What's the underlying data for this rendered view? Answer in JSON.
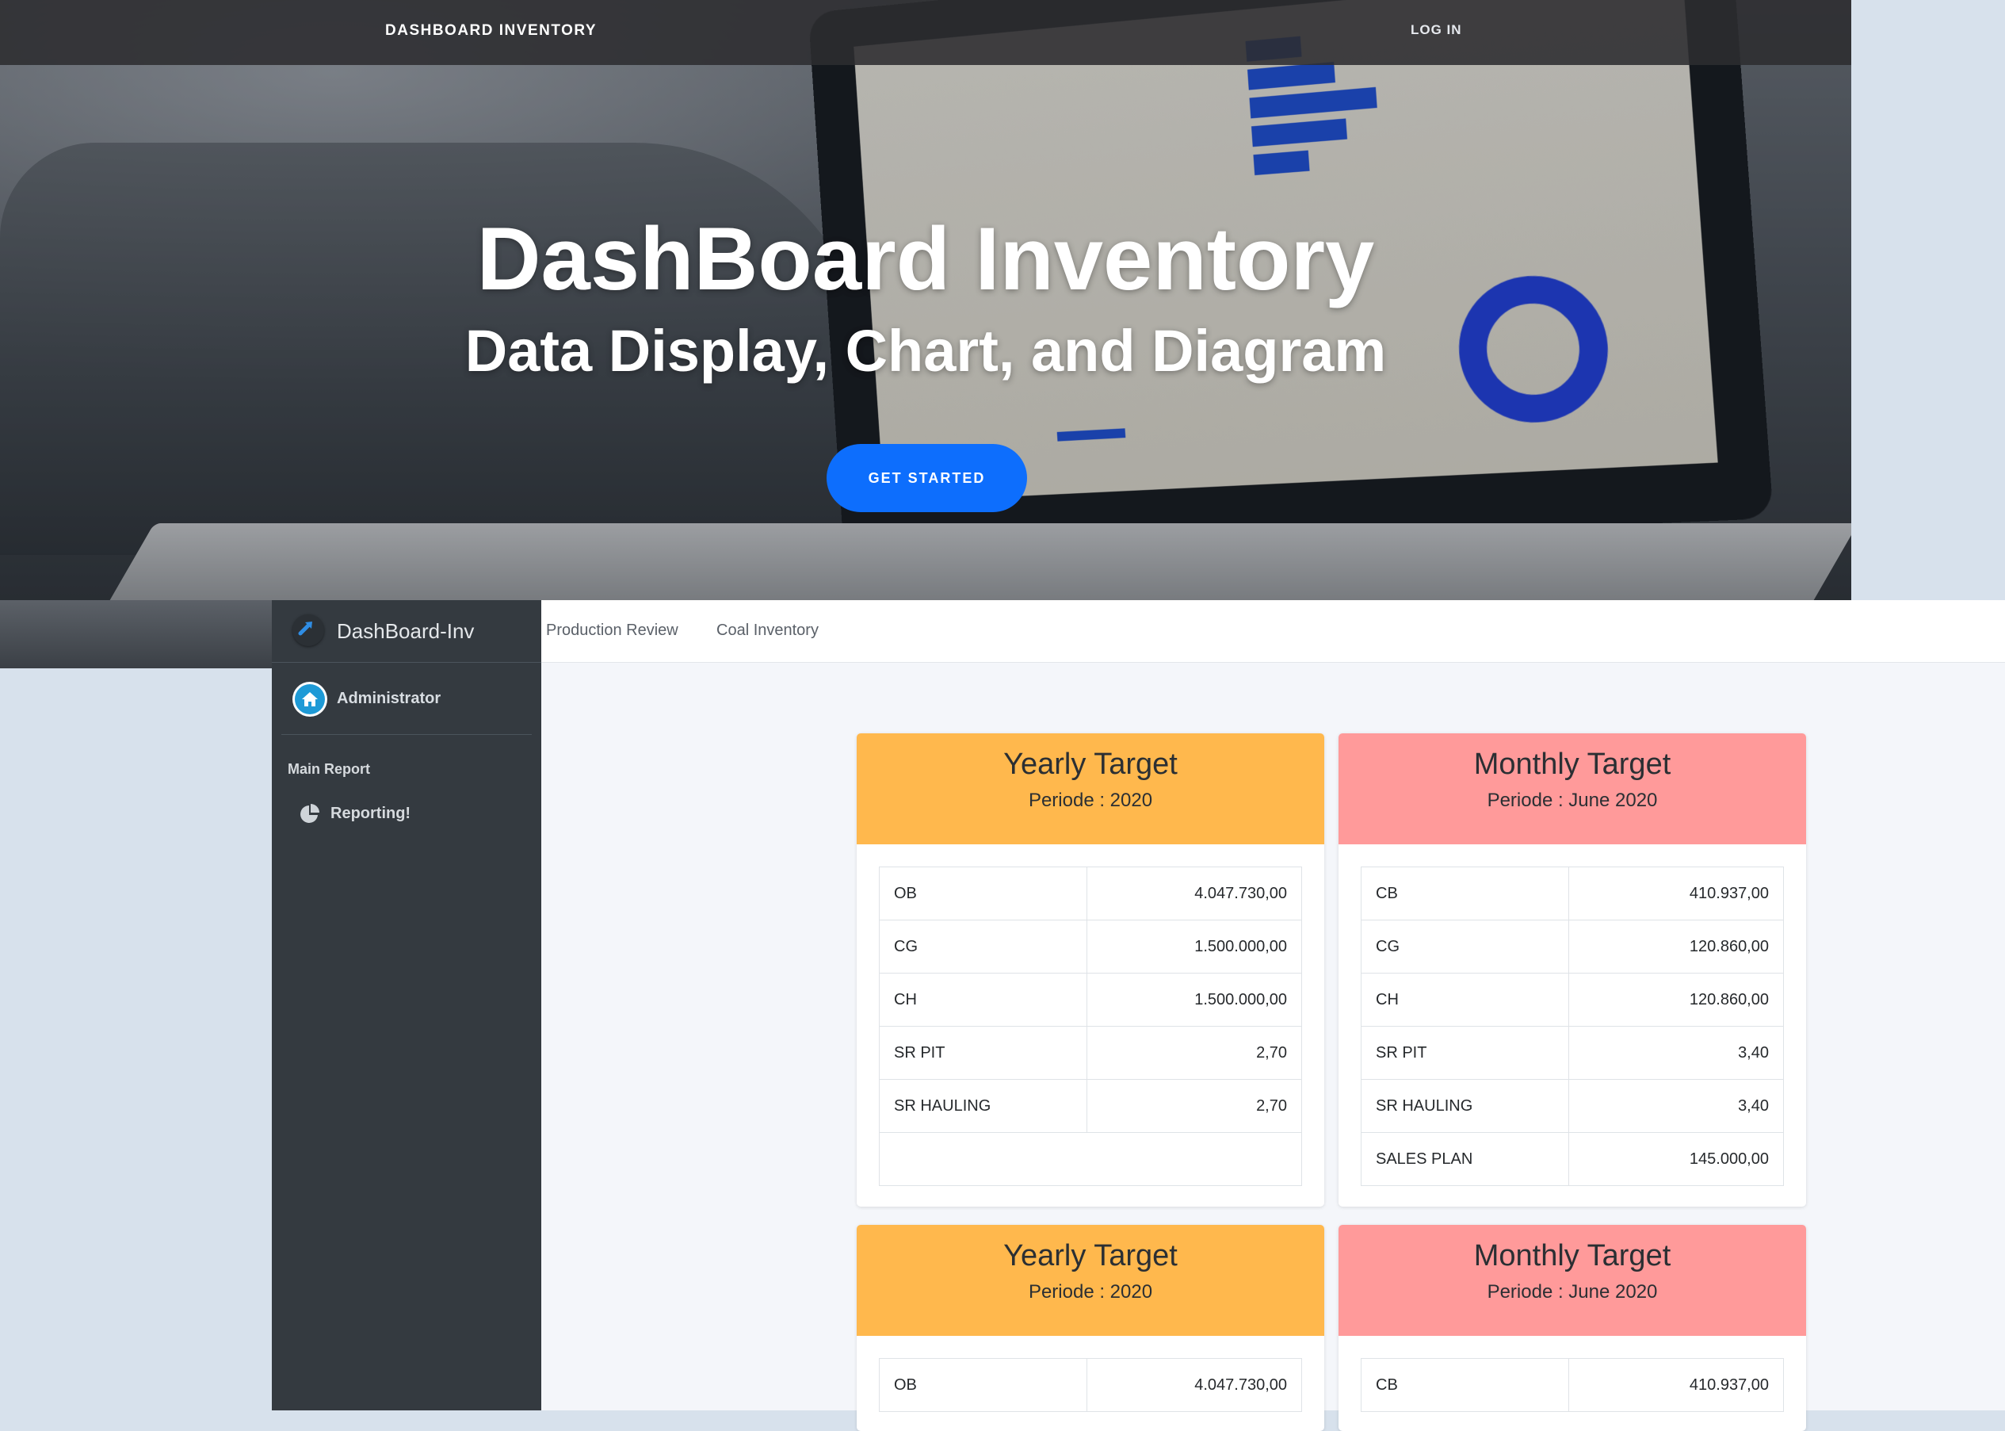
{
  "hero": {
    "brand": "DASHBOARD INVENTORY",
    "login": "LOG IN",
    "title": "DashBoard Inventory",
    "subtitle": "Data Display, Chart, and Diagram",
    "cta": "GET STARTED"
  },
  "topnav": {
    "links": [
      "Production Review",
      "Coal Inventory"
    ]
  },
  "sidebar": {
    "brand": "DashBoard-Inv",
    "user": "Administrator",
    "section": "Main Report",
    "items": [
      {
        "label": "Reporting!",
        "icon": "pie-chart-icon"
      }
    ]
  },
  "cards": [
    {
      "title": "Yearly Target",
      "periode": "Periode : 2020",
      "color": "#ffb84d",
      "rows": [
        {
          "key": "OB",
          "value": "4.047.730,00"
        },
        {
          "key": "CG",
          "value": "1.500.000,00"
        },
        {
          "key": "CH",
          "value": "1.500.000,00"
        },
        {
          "key": "SR PIT",
          "value": "2,70"
        },
        {
          "key": "SR HAULING",
          "value": "2,70"
        }
      ]
    },
    {
      "title": "Monthly Target",
      "periode": "Periode : June 2020",
      "color": "#ff9a9a",
      "rows": [
        {
          "key": "CB",
          "value": "410.937,00"
        },
        {
          "key": "CG",
          "value": "120.860,00"
        },
        {
          "key": "CH",
          "value": "120.860,00"
        },
        {
          "key": "SR PIT",
          "value": "3,40"
        },
        {
          "key": "SR HAULING",
          "value": "3,40"
        },
        {
          "key": "SALES PLAN",
          "value": "145.000,00"
        }
      ]
    },
    {
      "title": "Yearly Target",
      "periode": "Periode : 2020",
      "color": "#ffb84d",
      "rows": [
        {
          "key": "OB",
          "value": "4.047.730,00"
        }
      ]
    },
    {
      "title": "Monthly Target",
      "periode": "Periode : June 2020",
      "color": "#ff9a9a",
      "rows": [
        {
          "key": "CB",
          "value": "410.937,00"
        }
      ]
    }
  ]
}
